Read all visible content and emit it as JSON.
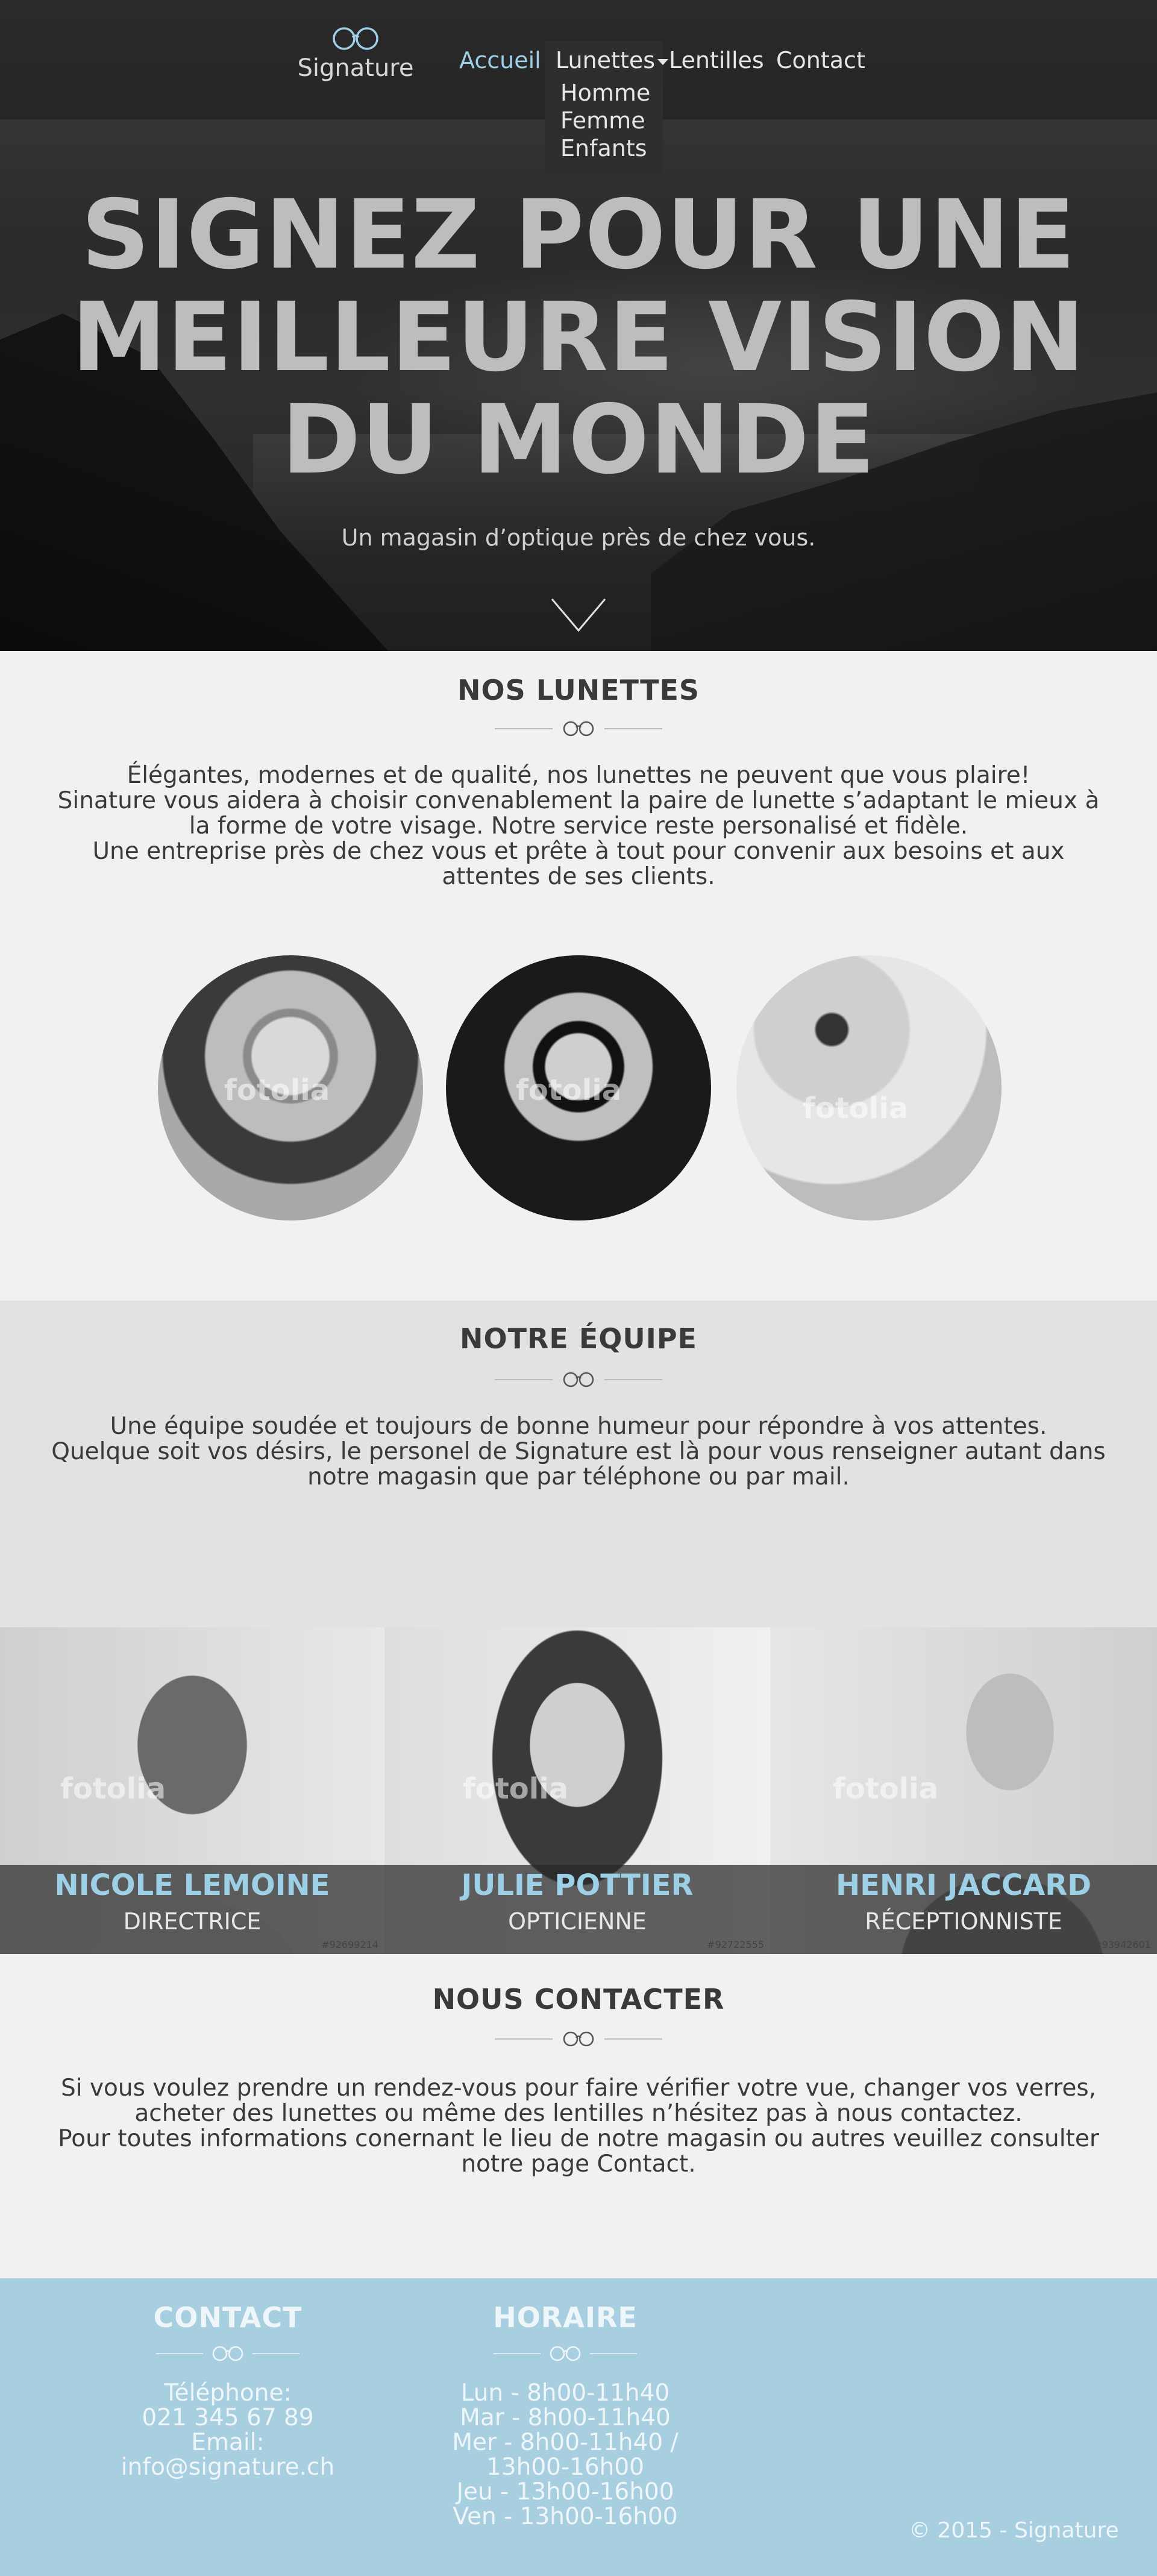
{
  "brand": {
    "name": "Signature",
    "accent": "#9dd0e6"
  },
  "nav": {
    "items": [
      "Accueil",
      "Lunettes",
      "Lentilles",
      "Contact"
    ],
    "active": "Accueil",
    "dropdown": {
      "label": "Lunettes",
      "items": [
        "Homme",
        "Femme",
        "Enfants"
      ]
    }
  },
  "hero": {
    "title_lines": [
      "SIGNEZ POUR UNE",
      "MEILLEURE VISION",
      "DU MONDE"
    ],
    "subtitle": "Un magasin d’optique près de chez vous.",
    "scroll_icon": "chevron-down-icon"
  },
  "lunettes": {
    "title": "NOS LUNETTES",
    "paragraph_lines": [
      "Élégantes, modernes et de qualité, nos lunettes ne peuvent que vous plaire!",
      "Sinature vous aidera à choisir convenablement la paire de lunette s’adaptant le mieux à",
      "la forme de votre visage. Notre service reste personalisé et fidèle.",
      "Une entreprise près de chez vous et prête à tout pour convenir aux besoins et aux",
      "attentes de ses clients."
    ],
    "photos_watermark": "fotolia"
  },
  "equipe": {
    "title": "NOTRE ÉQUIPE",
    "paragraph_lines": [
      "Une équipe soudée et toujours de bonne humeur pour répondre à vos attentes.",
      "Quelque soit vos désirs, le personel de Signature est là pour vous renseigner autant dans",
      "notre magasin que par téléphone ou par mail."
    ],
    "members": [
      {
        "name": "NICOLE LEMOINE",
        "role": "DIRECTRICE",
        "code": "#92699214"
      },
      {
        "name": "JULIE POTTIER",
        "role": "OPTICIENNE",
        "code": "#92722555"
      },
      {
        "name": "HENRI JACCARD",
        "role": "RÉCEPTIONNISTE",
        "code": "#93942601"
      }
    ],
    "watermark": "fotolia"
  },
  "contacter": {
    "title": "NOUS CONTACTER",
    "paragraph_lines": [
      "Si vous voulez prendre un rendez-vous pour faire vérifier votre vue, changer vos verres,",
      "acheter des lunettes ou même des lentilles n’hésitez pas à nous contactez.",
      "Pour toutes informations conernant le lieu de notre magasin ou autres veuillez consulter",
      "notre page Contact."
    ]
  },
  "footer": {
    "contact": {
      "title": "CONTACT",
      "lines": [
        "Téléphone:",
        "021 345 67 89",
        "Email:",
        "info@signature.ch"
      ]
    },
    "horaire": {
      "title": "HORAIRE",
      "lines": [
        "Lun - 8h00-11h40",
        "Mar - 8h00-11h40",
        "Mer - 8h00-11h40 /",
        "13h00-16h00",
        "Jeu - 13h00-16h00",
        "Ven - 13h00-16h00"
      ]
    },
    "copyright": "© 2015 - Signature"
  }
}
